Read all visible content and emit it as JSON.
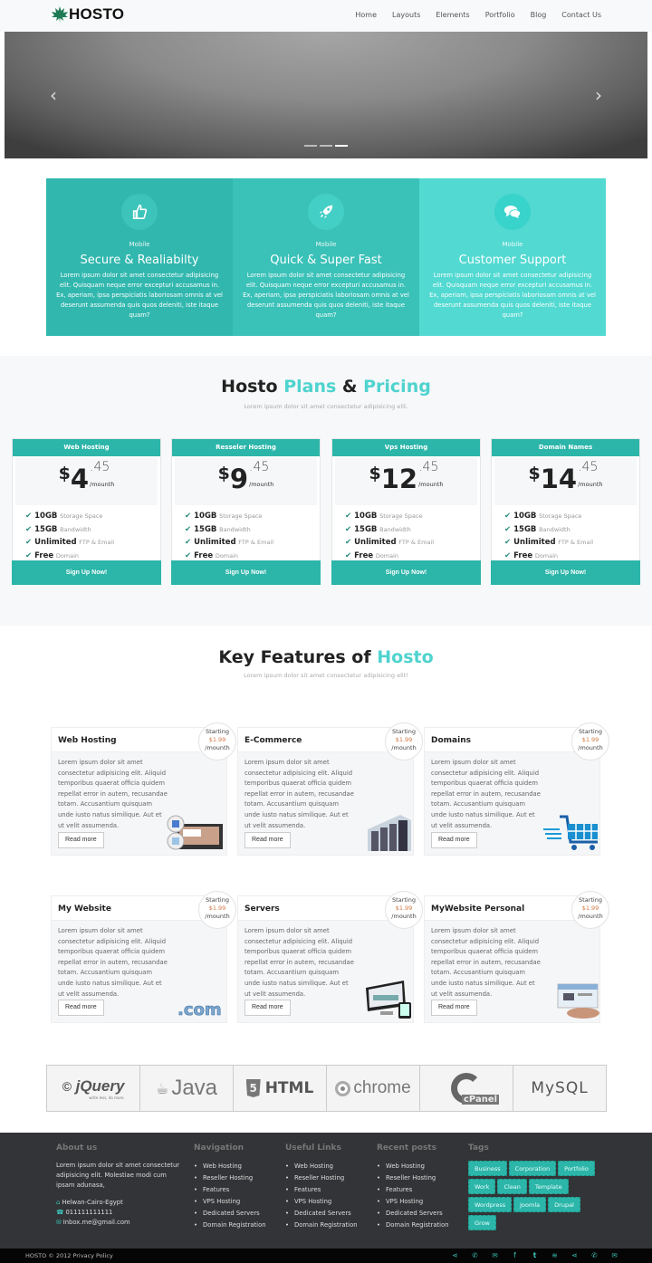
{
  "header": {
    "brand": "HOSTO",
    "nav": [
      "Home",
      "Layouts",
      "Elements",
      "Portfolio",
      "Blog",
      "Contact Us"
    ]
  },
  "slider": {
    "prev_icon": "chevron-left-icon",
    "next_icon": "chevron-right-icon",
    "slides_count": 3,
    "active_slide": 3
  },
  "strip": [
    {
      "icon": "thumbs-up-icon",
      "sub": "Mobile",
      "title": "Secure & Realiabilty",
      "text": "Lorem ipsum dolor sit amet consectetur adipisicing elit. Quisquam neque error excepturi accusamus in. Ex, aperiam, ipsa perspiciatis laboriosam omnis at vel deserunt assumenda quis quos deleniti, iste itaque quam?",
      "bg": "#31b7ae",
      "icon_bg": "#3cc3ba"
    },
    {
      "icon": "rocket-icon",
      "sub": "Mobile",
      "title": "Quick & Super Fast",
      "text": "Lorem ipsum dolor sit amet consectetur adipisicing elit. Quisquam neque error excepturi accusamus in. Ex, aperiam, ipsa perspiciatis laboriosam omnis at vel deserunt assumenda quis quos deleniti, iste itaque quam?",
      "bg": "#3ac1b8",
      "icon_bg": "#44cfc6"
    },
    {
      "icon": "comments-icon",
      "sub": "Mobile",
      "title": "Customer Support",
      "text": "Lorem ipsum dolor sit amet consectetur adipisicing elit. Quisquam neque error excepturi accusamus in. Ex, aperiam, ipsa perspiciatis laboriosam omnis at vel deserunt assumenda quis quos deleniti, iste itaque quam?",
      "bg": "#52d9d1",
      "icon_bg": "#38d3cb"
    }
  ],
  "pricing": {
    "title_a": "Hosto ",
    "title_b": "Plans",
    "title_c": " & ",
    "title_d": "Pricing",
    "subtitle": "Lorem ipsum dolor sit amet consectetur adipisicing elit.",
    "plans": [
      {
        "name": "Web Hosting",
        "currency": "$",
        "amount": "4",
        "cents": ".45",
        "period": "/mounth",
        "button": "Sign Up Now!"
      },
      {
        "name": "Resseler Hosting",
        "currency": "$",
        "amount": "9",
        "cents": ".45",
        "period": "/mounth",
        "button": "Sign Up Now!"
      },
      {
        "name": "Vps Hosting",
        "currency": "$",
        "amount": "12",
        "cents": ".45",
        "period": "/mounth",
        "button": "Sign Up Now!"
      },
      {
        "name": "Domain Names",
        "currency": "$",
        "amount": "14",
        "cents": ".45",
        "period": "/mounth",
        "button": "Sign Up Now!"
      }
    ],
    "features": [
      {
        "bold": "10GB",
        "light": "Storage Space"
      },
      {
        "bold": "15GB",
        "light": "Bandwidth"
      },
      {
        "bold": "Unlimited",
        "light": "FTP & Email"
      },
      {
        "bold": "Free",
        "light": "Domain"
      }
    ]
  },
  "key_features": {
    "title_a": "Key Features of ",
    "title_b": "Hosto",
    "subtitle": "Lorem ipsum dolor sit amet consectetur adipisicing elit!",
    "badge": {
      "starting": "Starting",
      "price": "$1.99",
      "period": "/mounth"
    },
    "read_more": "Read more",
    "text": "Lorem ipsum dolor sit amet consectetur adipisicing elit. Aliquid temporibus quaerat officia quidem repellat error in autem, recusandae totam. Accusantium quisquam unde iusto natus similique. Aut et ut velit assumenda.",
    "cards": [
      {
        "title": "Web Hosting",
        "image": "web-hosting-illustration"
      },
      {
        "title": "E-Commerce",
        "image": "server-rack-image"
      },
      {
        "title": "Domains",
        "image": "shopping-cart-icon"
      },
      {
        "title": "My Website",
        "image": "dotcom-logo-image"
      },
      {
        "title": "Servers",
        "image": "devices-image"
      },
      {
        "title": "MyWebsite Personal",
        "image": "personal-site-image"
      }
    ]
  },
  "logos": [
    "jQuery",
    "Java",
    "HTML",
    "chrome",
    "cPanel",
    "MySQL"
  ],
  "logo_extras": {
    "jquery_tagline": "write less, do more."
  },
  "footer": {
    "about": {
      "title": "About us",
      "text": "Lorem ipsum dolor sit amet consectetur adipisicing elit. Molestiae modi cum ipsam adunasa,",
      "address": "Helwan-Cairo-Egypt",
      "phone": "011111111111",
      "email": "Inbox.me@gmail.com"
    },
    "navigation": {
      "title": "Navigation",
      "items": [
        "Web Hosting",
        "Reseller Hosting",
        "Features",
        "VPS Hosting",
        "Dedicated Servers",
        "Domain Registration"
      ]
    },
    "useful": {
      "title": "Useful Links",
      "items": [
        "Web Hosting",
        "Reseller Hosting",
        "Features",
        "VPS Hosting",
        "Dedicated Servers",
        "Domain Registration"
      ]
    },
    "recent": {
      "title": "Recent posts",
      "items": [
        "Web Hosting",
        "Reseller Hosting",
        "Features",
        "VPS Hosting",
        "Dedicated Servers",
        "Domain Registration"
      ]
    },
    "tags": {
      "title": "Tags",
      "items": [
        "Business",
        "Corporation",
        "Portfolio",
        "Work",
        "Clean",
        "Template",
        "Wordpress",
        "Joomla",
        "Drupal",
        "Grow"
      ]
    },
    "copyright": "HOSTO © 2012 Privacy Policy",
    "social": [
      "share-icon",
      "phone-icon",
      "mail-icon",
      "facebook-icon",
      "twitter-icon",
      "wifi-icon",
      "share-icon",
      "phone-icon",
      "mail-icon"
    ]
  },
  "colors": {
    "accent": "#2cb5a9",
    "accent_light": "#4fd3ce",
    "footer_bg": "#333437",
    "price_highlight": "#d07a45"
  }
}
